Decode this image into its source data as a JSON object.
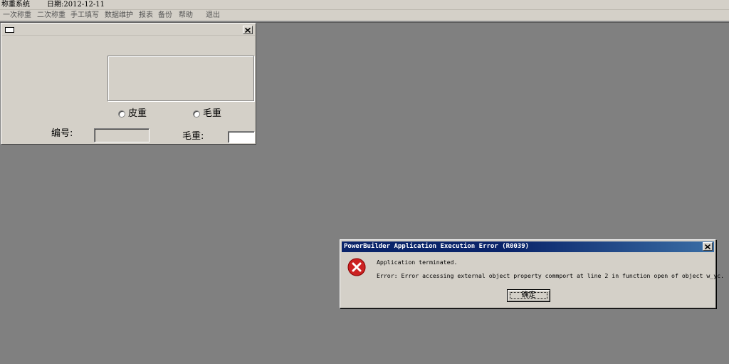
{
  "app": {
    "title": "称重系统",
    "date_label": "日期:2012-12-11"
  },
  "menu": {
    "items": [
      "一次称重",
      "二次称重",
      "手工填写",
      "数据维护",
      "报表",
      "备份",
      "帮助",
      "退出"
    ]
  },
  "child_window": {
    "title": "",
    "radio_tare": "皮重",
    "radio_gross": "毛重",
    "number_label": "编号:",
    "gross_label": "毛重:",
    "number_value": "",
    "gross_value": ""
  },
  "dialog": {
    "title": "PowerBuilder Application Execution Error (R0039)",
    "line1": "Application terminated.",
    "line2": "Error: Error accessing external object property commport at line 2 in function open of object w_yc.",
    "ok_label": "确定"
  },
  "icons": {
    "error": "error-icon",
    "close": "close-icon"
  },
  "colors": {
    "face": "#d4d0c8",
    "workspace": "#808080",
    "caption_active": "#0a246a",
    "error_red": "#cc2222"
  }
}
